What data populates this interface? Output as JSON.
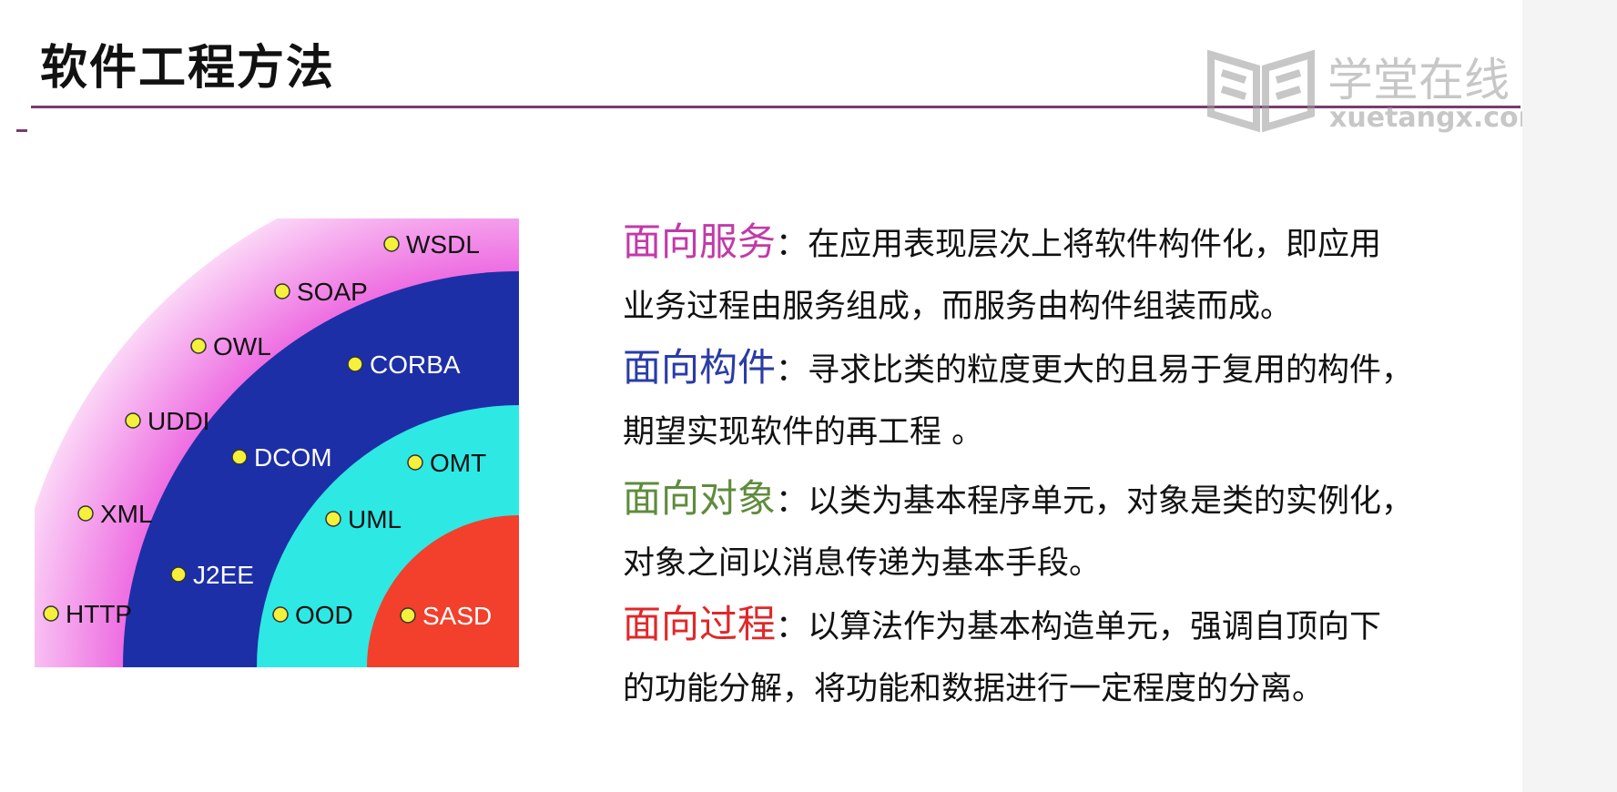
{
  "slide": {
    "title": "软件工程方法",
    "logo": {
      "name": "学堂在线",
      "url": "xuetangx.com"
    }
  },
  "diagram": {
    "rings": [
      {
        "id": "service",
        "color": "#f078e6",
        "items": [
          "WSDL",
          "SOAP",
          "OWL",
          "UDDI",
          "XML",
          "HTTP"
        ]
      },
      {
        "id": "component",
        "color": "#1d2fa6",
        "items": [
          "CORBA",
          "DCOM",
          "J2EE"
        ]
      },
      {
        "id": "object",
        "color": "#2ee8e4",
        "items": [
          "OMT",
          "UML",
          "OOD"
        ]
      },
      {
        "id": "process",
        "color": "#f2402c",
        "items": [
          "SASD"
        ]
      }
    ]
  },
  "methods": [
    {
      "head": "面向服务",
      "color": "#c23aa8",
      "line1": "：在应用表现层次上将软件构件化，即应用",
      "line2": "业务过程由服务组成，而服务由构件组装而成。"
    },
    {
      "head": "面向构件",
      "color": "#2a3ca6",
      "line1": "：寻求比类的粒度更大的且易于复用的构件，",
      "line2": "期望实现软件的再工程 。"
    },
    {
      "head": "面向对象",
      "color": "#5e8c3c",
      "line1": "：以类为基本程序单元，对象是类的实例化，",
      "line2": "对象之间以消息传递为基本手段。"
    },
    {
      "head": "面向过程",
      "color": "#e0282a",
      "line1": "：以算法作为基本构造单元，强调自顶向下",
      "line2": "的功能分解，将功能和数据进行一定程度的分离。"
    }
  ]
}
